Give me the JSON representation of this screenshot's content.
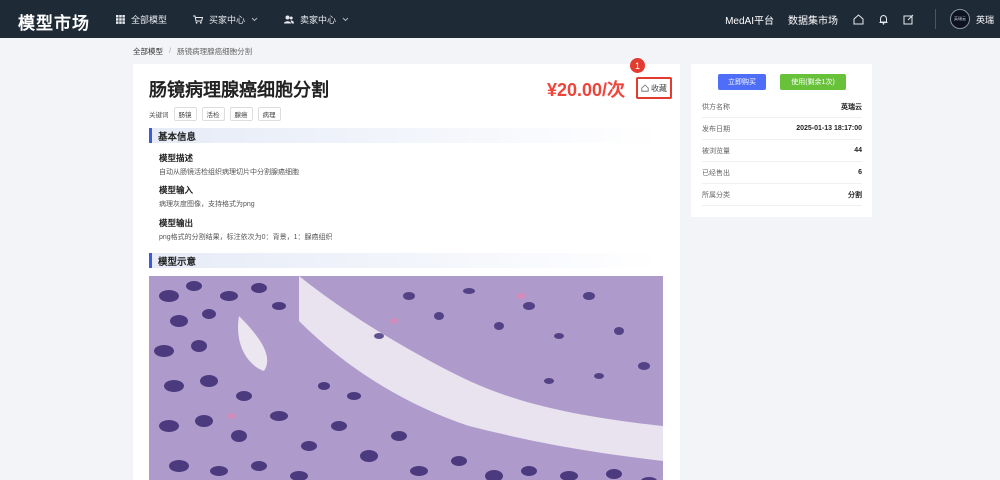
{
  "header": {
    "brand": "模型市场",
    "nav": [
      {
        "label": "全部模型",
        "icon": "grid-icon"
      },
      {
        "label": "买家中心",
        "icon": "cart-icon"
      },
      {
        "label": "卖家中心",
        "icon": "users-icon"
      }
    ],
    "links": [
      "MedAI平台",
      "数据集市场"
    ],
    "icons": [
      "home-icon",
      "bell-icon",
      "edit-icon"
    ],
    "avatar_text": "英瑞云",
    "username": "英瑞"
  },
  "breadcrumb": {
    "home": "全部模型",
    "separator": "/",
    "current": "肠镜病理腺癌细胞分割"
  },
  "product": {
    "title": "肠镜病理腺癌细胞分割",
    "price": "¥20.00/次",
    "favorite_label": "收藏",
    "marker": "1",
    "keywords_label": "关键词",
    "keywords": [
      "肠镜",
      "活检",
      "腺癌",
      "病理"
    ]
  },
  "basic_info": {
    "heading": "基本信息",
    "desc_title": "模型描述",
    "desc_text": "自动从肠镜活检组织病理切片中分割腺癌细胞",
    "input_title": "模型输入",
    "input_text": "病理灰度图像，支持格式为png",
    "output_title": "模型输出",
    "output_text": "png格式的分割结果，标注依次为0：背景，1：腺癌组织"
  },
  "demo": {
    "heading": "模型示意"
  },
  "side": {
    "buy_label": "立即购买",
    "use_label": "使用(剩余1次)",
    "rows": [
      {
        "label": "供方名称",
        "value": "英瑞云"
      },
      {
        "label": "发布日期",
        "value": "2025-01-13 18:17:00"
      },
      {
        "label": "被浏览量",
        "value": "44"
      },
      {
        "label": "已经售出",
        "value": "6"
      },
      {
        "label": "所属分类",
        "value": "分割"
      }
    ]
  },
  "colors": {
    "topbar": "#1f2a37",
    "price": "#f0433a",
    "primary": "#4f6ef7",
    "success": "#67c23a",
    "marker": "#e23b2f"
  }
}
